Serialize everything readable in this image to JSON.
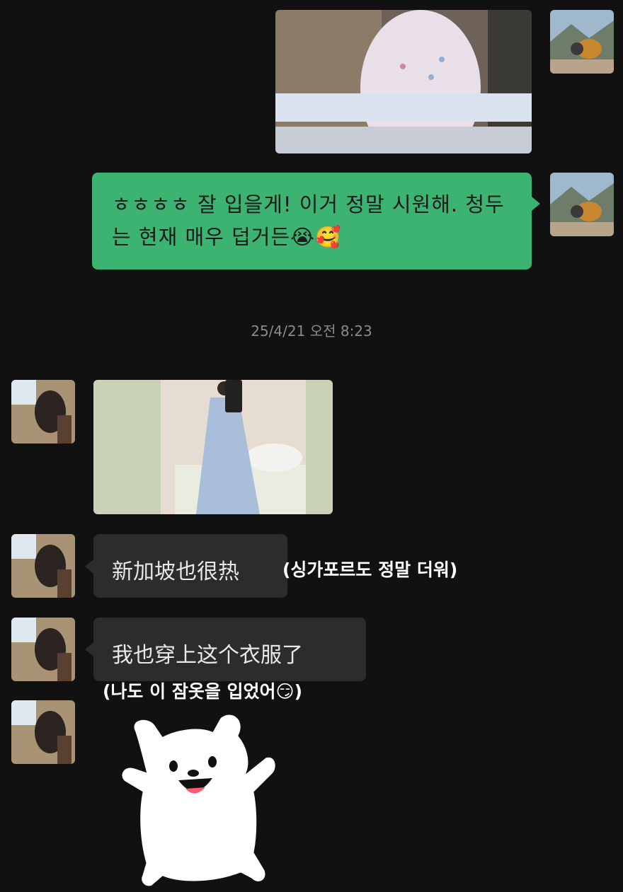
{
  "colors": {
    "background": "#111111",
    "my_bubble": "#3cb371",
    "other_bubble": "#2c2c2c",
    "timestamp_text": "#8a8a8a"
  },
  "messages_top": {
    "sent_photo": {
      "icon": "outfit-photo"
    },
    "sent_text": "ㅎㅎㅎㅎ 잘 입을게! 이거 정말 시원해. 청두는 현재 매우 덥거든",
    "sent_text_emojis": [
      "😭",
      "🥰"
    ]
  },
  "timestamp": "25/4/21 오전 8:23",
  "messages_bottom": {
    "photo": {
      "icon": "mirror-selfie-photo"
    },
    "msg1": "新加坡也很热",
    "msg1_caption": "(싱가포르도 정말 더워)",
    "msg2": "我也穿上这个衣服了",
    "msg2_caption": "(나도 이 잠옷을 입었어",
    "msg2_caption_emoji": "😏",
    "msg2_caption_close": ")",
    "sticker": {
      "icon": "white-puppy-sticker"
    }
  }
}
